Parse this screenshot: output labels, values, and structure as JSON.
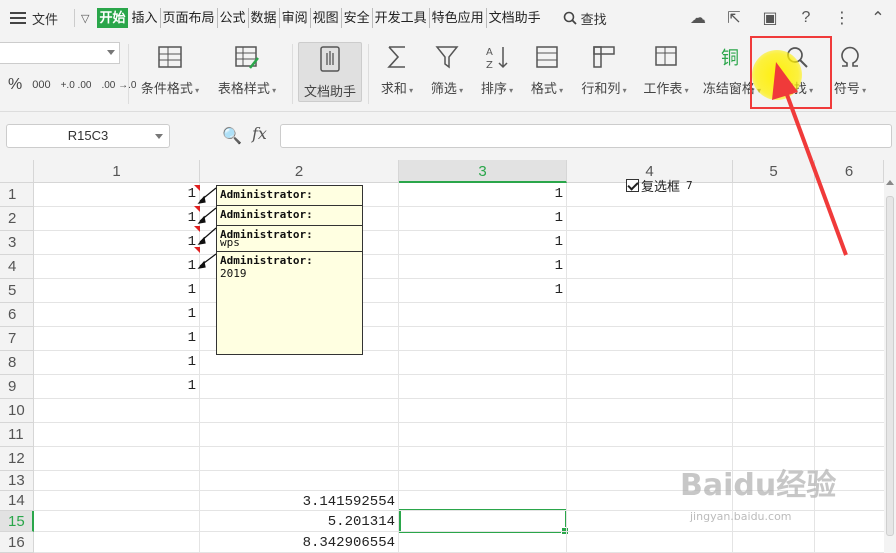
{
  "menu": {
    "file_label": "文件",
    "tabs": [
      "开始",
      "插入",
      "页面布局",
      "公式",
      "数据",
      "审阅",
      "视图",
      "安全",
      "开发工具",
      "特色应用",
      "文档助手"
    ],
    "search_label": "查找"
  },
  "ribbon": {
    "numfmt": {
      "percent": "%",
      "thousands": "000",
      "inc_decimal": "+.0 .00",
      "dec_decimal": ".00 →.0"
    },
    "buttons": {
      "cond_format": "条件格式",
      "table_style": "表格样式",
      "doc_helper": "文档助手",
      "sum": "求和",
      "filter": "筛选",
      "sort": "排序",
      "format": "格式",
      "row_col": "行和列",
      "worksheet": "工作表",
      "freeze": "冻结窗格",
      "find": "查找",
      "symbol": "符号"
    }
  },
  "formula_bar": {
    "name_box": "R15C3",
    "fx_label": "fx",
    "formula": ""
  },
  "grid": {
    "columns": [
      "1",
      "2",
      "3",
      "4",
      "5",
      "6"
    ],
    "rows": [
      "1",
      "2",
      "3",
      "4",
      "5",
      "6",
      "7",
      "8",
      "9",
      "10",
      "11",
      "12",
      "13",
      "14",
      "15",
      "16"
    ],
    "selected_column": "3",
    "selected_row": "15",
    "col1_values": [
      "1",
      "1",
      "1",
      "1",
      "1",
      "1",
      "1",
      "1",
      "1"
    ],
    "col3_values": [
      "1",
      "1",
      "1",
      "1",
      "1"
    ],
    "col2_values": {
      "r14": "3.141592554",
      "r15": "5.201314",
      "r16": "8.342906554"
    }
  },
  "comments": {
    "author": "Administrator:",
    "obscured_text": "wps",
    "last_text": "2019"
  },
  "checkbox": {
    "label": "复选框",
    "number": "7",
    "checked": true
  },
  "watermark": {
    "main": "Baidu经验",
    "sub": "jingyan.baidu.com"
  },
  "colors": {
    "accent_green": "#2aa64a",
    "highlight_red": "#f03a3a",
    "comment_bg": "#ffffe1"
  }
}
